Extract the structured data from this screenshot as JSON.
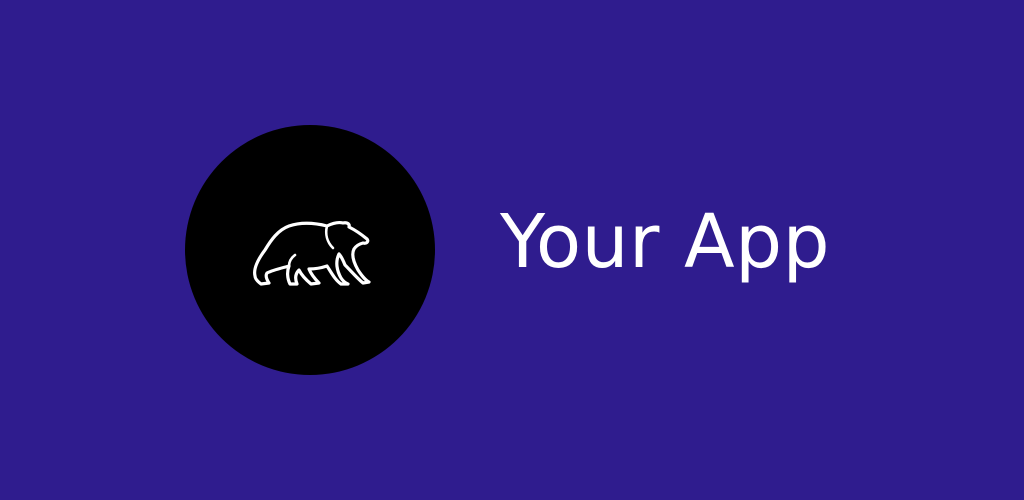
{
  "banner": {
    "title": "Your App",
    "logo_icon": "bear-icon"
  },
  "colors": {
    "background": "#2f1c8e",
    "logo_circle": "#000000",
    "text": "#ffffff"
  }
}
